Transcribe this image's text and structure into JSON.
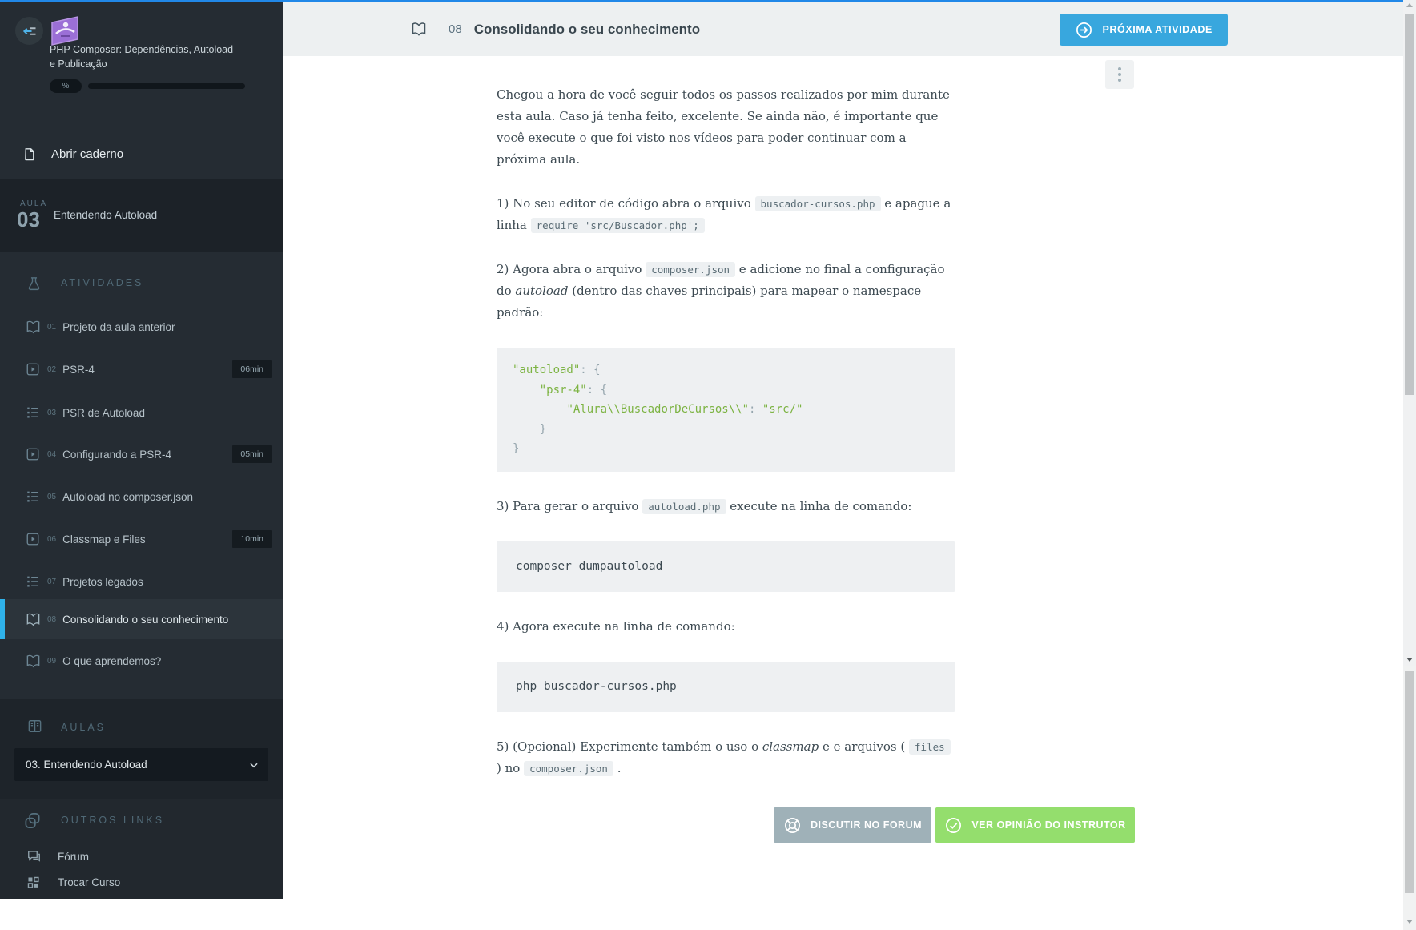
{
  "colors": {
    "top_bar_blue": "#2188e8",
    "primary_button_blue": "#38a7de",
    "active_item_blue": "#2fb2ea",
    "forum_button_gray": "#9fb1b8",
    "instructor_button_green": "#94de6d",
    "code_green": "#7cb342",
    "sidebar_bg": "#252c33"
  },
  "sidebar": {
    "course_title": "PHP Composer: Dependências, Autoload e Publicação",
    "progress_badge": "%",
    "notebook": "Abrir caderno",
    "lesson_kicker": "AULA",
    "lesson_number": "03",
    "lesson_title": "Entendendo Autoload",
    "activities_header": "ATIVIDADES",
    "activities": [
      {
        "num": "01",
        "label": "Projeto da aula anterior",
        "duration": ""
      },
      {
        "num": "02",
        "label": "PSR-4",
        "duration": "06min"
      },
      {
        "num": "03",
        "label": "PSR de Autoload",
        "duration": ""
      },
      {
        "num": "04",
        "label": "Configurando a PSR-4",
        "duration": "05min"
      },
      {
        "num": "05",
        "label": "Autoload no composer.json",
        "duration": ""
      },
      {
        "num": "06",
        "label": "Classmap e Files",
        "duration": "10min"
      },
      {
        "num": "07",
        "label": "Projetos legados",
        "duration": ""
      },
      {
        "num": "08",
        "label": "Consolidando o seu conhecimento",
        "duration": ""
      },
      {
        "num": "09",
        "label": "O que aprendemos?",
        "duration": ""
      }
    ],
    "aulas_header": "AULAS",
    "aulas_selected": "03. Entendendo Autoload",
    "links_header": "OUTROS LINKS",
    "forum": "Fórum",
    "switch_course": "Trocar Curso"
  },
  "header": {
    "number": "08",
    "title": "Consolidando o seu conhecimento",
    "next_button": "PRÓXIMA ATIVIDADE"
  },
  "article": {
    "p1": "Chegou a hora de você seguir todos os passos realizados por mim durante esta aula. Caso já tenha feito, excelente. Se ainda não, é importante que você execute o que foi visto nos vídeos para poder continuar com a próxima aula.",
    "p2": {
      "a": "1) No seu editor de código abra o arquivo ",
      "code1": "buscador-cursos.php",
      "b": " e apague a linha ",
      "code2": "require 'src/Buscador.php';"
    },
    "p3": {
      "a": "2) Agora abra o arquivo ",
      "code1": "composer.json",
      "b": " e adicione no final a configuração do ",
      "em": "autoload",
      "c": " (dentro das chaves principais) para mapear o namespace padrão:"
    },
    "code_json": {
      "l1a": "\"autoload\"",
      "l1b": ": {",
      "ind2": "    ",
      "l2a": "\"psr-4\"",
      "l2b": ": {",
      "ind3": "        ",
      "l3a": "\"Alura\\\\BuscadorDeCursos\\\\\"",
      "l3b": ": ",
      "l3c": "\"src/\"",
      "l4": "    }",
      "l5": "}"
    },
    "p4": {
      "a": "3) Para gerar o arquivo ",
      "code1": "autoload.php",
      "b": " execute na linha de comando:"
    },
    "cmd1": "composer dumpautoload",
    "p5": "4) Agora execute na linha de comando:",
    "cmd2": "php buscador-cursos.php",
    "p6": {
      "a": "5) (Opcional) Experimente também o uso o ",
      "em": "classmap",
      "b": " e e arquivos ( ",
      "code1": "files",
      "c": " ) no ",
      "code2": "composer.json",
      "d": " ."
    },
    "forum_button": "DISCUTIR NO FORUM",
    "instructor_button": "VER OPINIÃO DO INSTRUTOR"
  }
}
